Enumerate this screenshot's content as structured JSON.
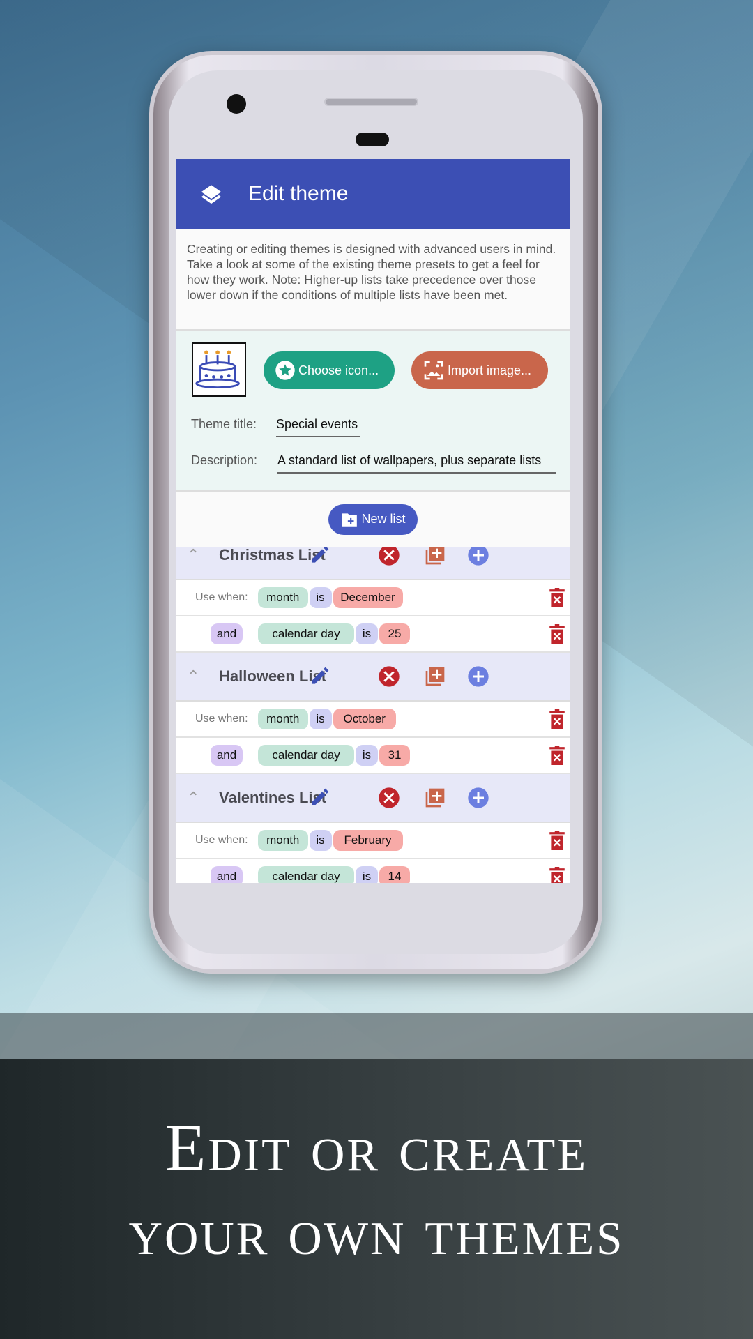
{
  "header": {
    "title": "Edit theme",
    "icon": "layers-icon"
  },
  "description": "Creating or editing themes is designed with advanced users in mind. Take a look at some of the existing theme presets to get a feel for how they work. Note: Higher-up lists take precedence over those lower down if the conditions of multiple lists have been met.",
  "buttons": {
    "choose_icon": "Choose icon...",
    "import_image": "Import image...",
    "new_list": "New list"
  },
  "fields": {
    "title_label": "Theme title:",
    "title_value": "Special events",
    "description_label": "Description:",
    "description_value": "A standard list of wallpapers, plus separate lists"
  },
  "lists": [
    {
      "name": "Christmas List",
      "conditions": [
        {
          "prefix": "Use when:",
          "field": "month",
          "op": "is",
          "value": "December"
        },
        {
          "prefix": "and",
          "field": "calendar day",
          "op": "is",
          "value": "25"
        }
      ]
    },
    {
      "name": "Halloween List",
      "conditions": [
        {
          "prefix": "Use when:",
          "field": "month",
          "op": "is",
          "value": "October"
        },
        {
          "prefix": "and",
          "field": "calendar day",
          "op": "is",
          "value": "31"
        }
      ]
    },
    {
      "name": "Valentines List",
      "conditions": [
        {
          "prefix": "Use when:",
          "field": "month",
          "op": "is",
          "value": "February"
        },
        {
          "prefix": "and",
          "field": "calendar day",
          "op": "is",
          "value": "14"
        }
      ]
    }
  ],
  "tagline": {
    "line1": "Edit or create",
    "line2": "your own themes"
  },
  "colors": {
    "header": "#3c4fb4",
    "choose": "#1ea184",
    "import": "#c9664b",
    "delete": "#c0252c"
  }
}
